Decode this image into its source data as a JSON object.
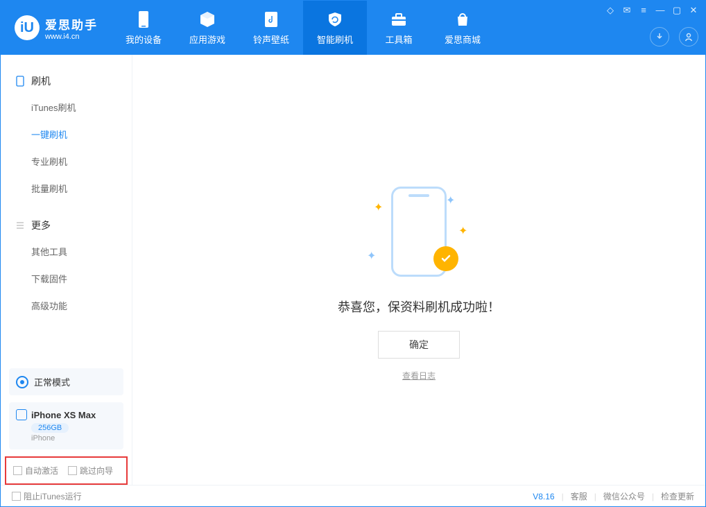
{
  "app": {
    "title": "爱思助手",
    "subtitle": "www.i4.cn"
  },
  "header_tabs": [
    {
      "label": "我的设备"
    },
    {
      "label": "应用游戏"
    },
    {
      "label": "铃声壁纸"
    },
    {
      "label": "智能刷机"
    },
    {
      "label": "工具箱"
    },
    {
      "label": "爱思商城"
    }
  ],
  "sidebar": {
    "group1_title": "刷机",
    "items1": [
      {
        "label": "iTunes刷机"
      },
      {
        "label": "一键刷机"
      },
      {
        "label": "专业刷机"
      },
      {
        "label": "批量刷机"
      }
    ],
    "group2_title": "更多",
    "items2": [
      {
        "label": "其他工具"
      },
      {
        "label": "下载固件"
      },
      {
        "label": "高级功能"
      }
    ],
    "mode_label": "正常模式",
    "device_name": "iPhone XS Max",
    "device_capacity": "256GB",
    "device_type": "iPhone",
    "opt1": "自动激活",
    "opt2": "跳过向导"
  },
  "main": {
    "message": "恭喜您，保资料刷机成功啦！",
    "ok_label": "确定",
    "log_link": "查看日志"
  },
  "footer": {
    "block_itunes": "阻止iTunes运行",
    "version": "V8.16",
    "link1": "客服",
    "link2": "微信公众号",
    "link3": "检查更新"
  }
}
